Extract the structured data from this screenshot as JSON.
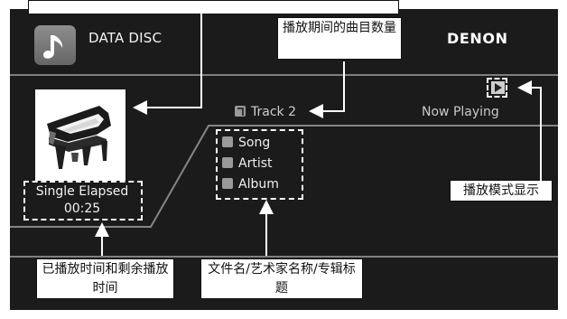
{
  "screen": {
    "source_label": "DATA DISC",
    "brand": "DENON",
    "track": "Track 2",
    "status": "Now Playing",
    "metadata": [
      {
        "label": "Song",
        "icon": "music-note-icon"
      },
      {
        "label": "Artist",
        "icon": "artist-icon"
      },
      {
        "label": "Album",
        "icon": "album-icon"
      }
    ],
    "elapsed_mode": "Single Elapsed",
    "elapsed_time": "00:25"
  },
  "annotations": {
    "track_count": "播放期间的曲目数量",
    "play_mode": "播放模式显示",
    "elapsed": "已播放时间和剩余播放时间",
    "metadata": "文件名/艺术家名称/专辑标题"
  },
  "colors": {
    "screen_background": "#1b1b1b",
    "separator": "#7f7f7f",
    "callout_background": "#ffffff"
  }
}
